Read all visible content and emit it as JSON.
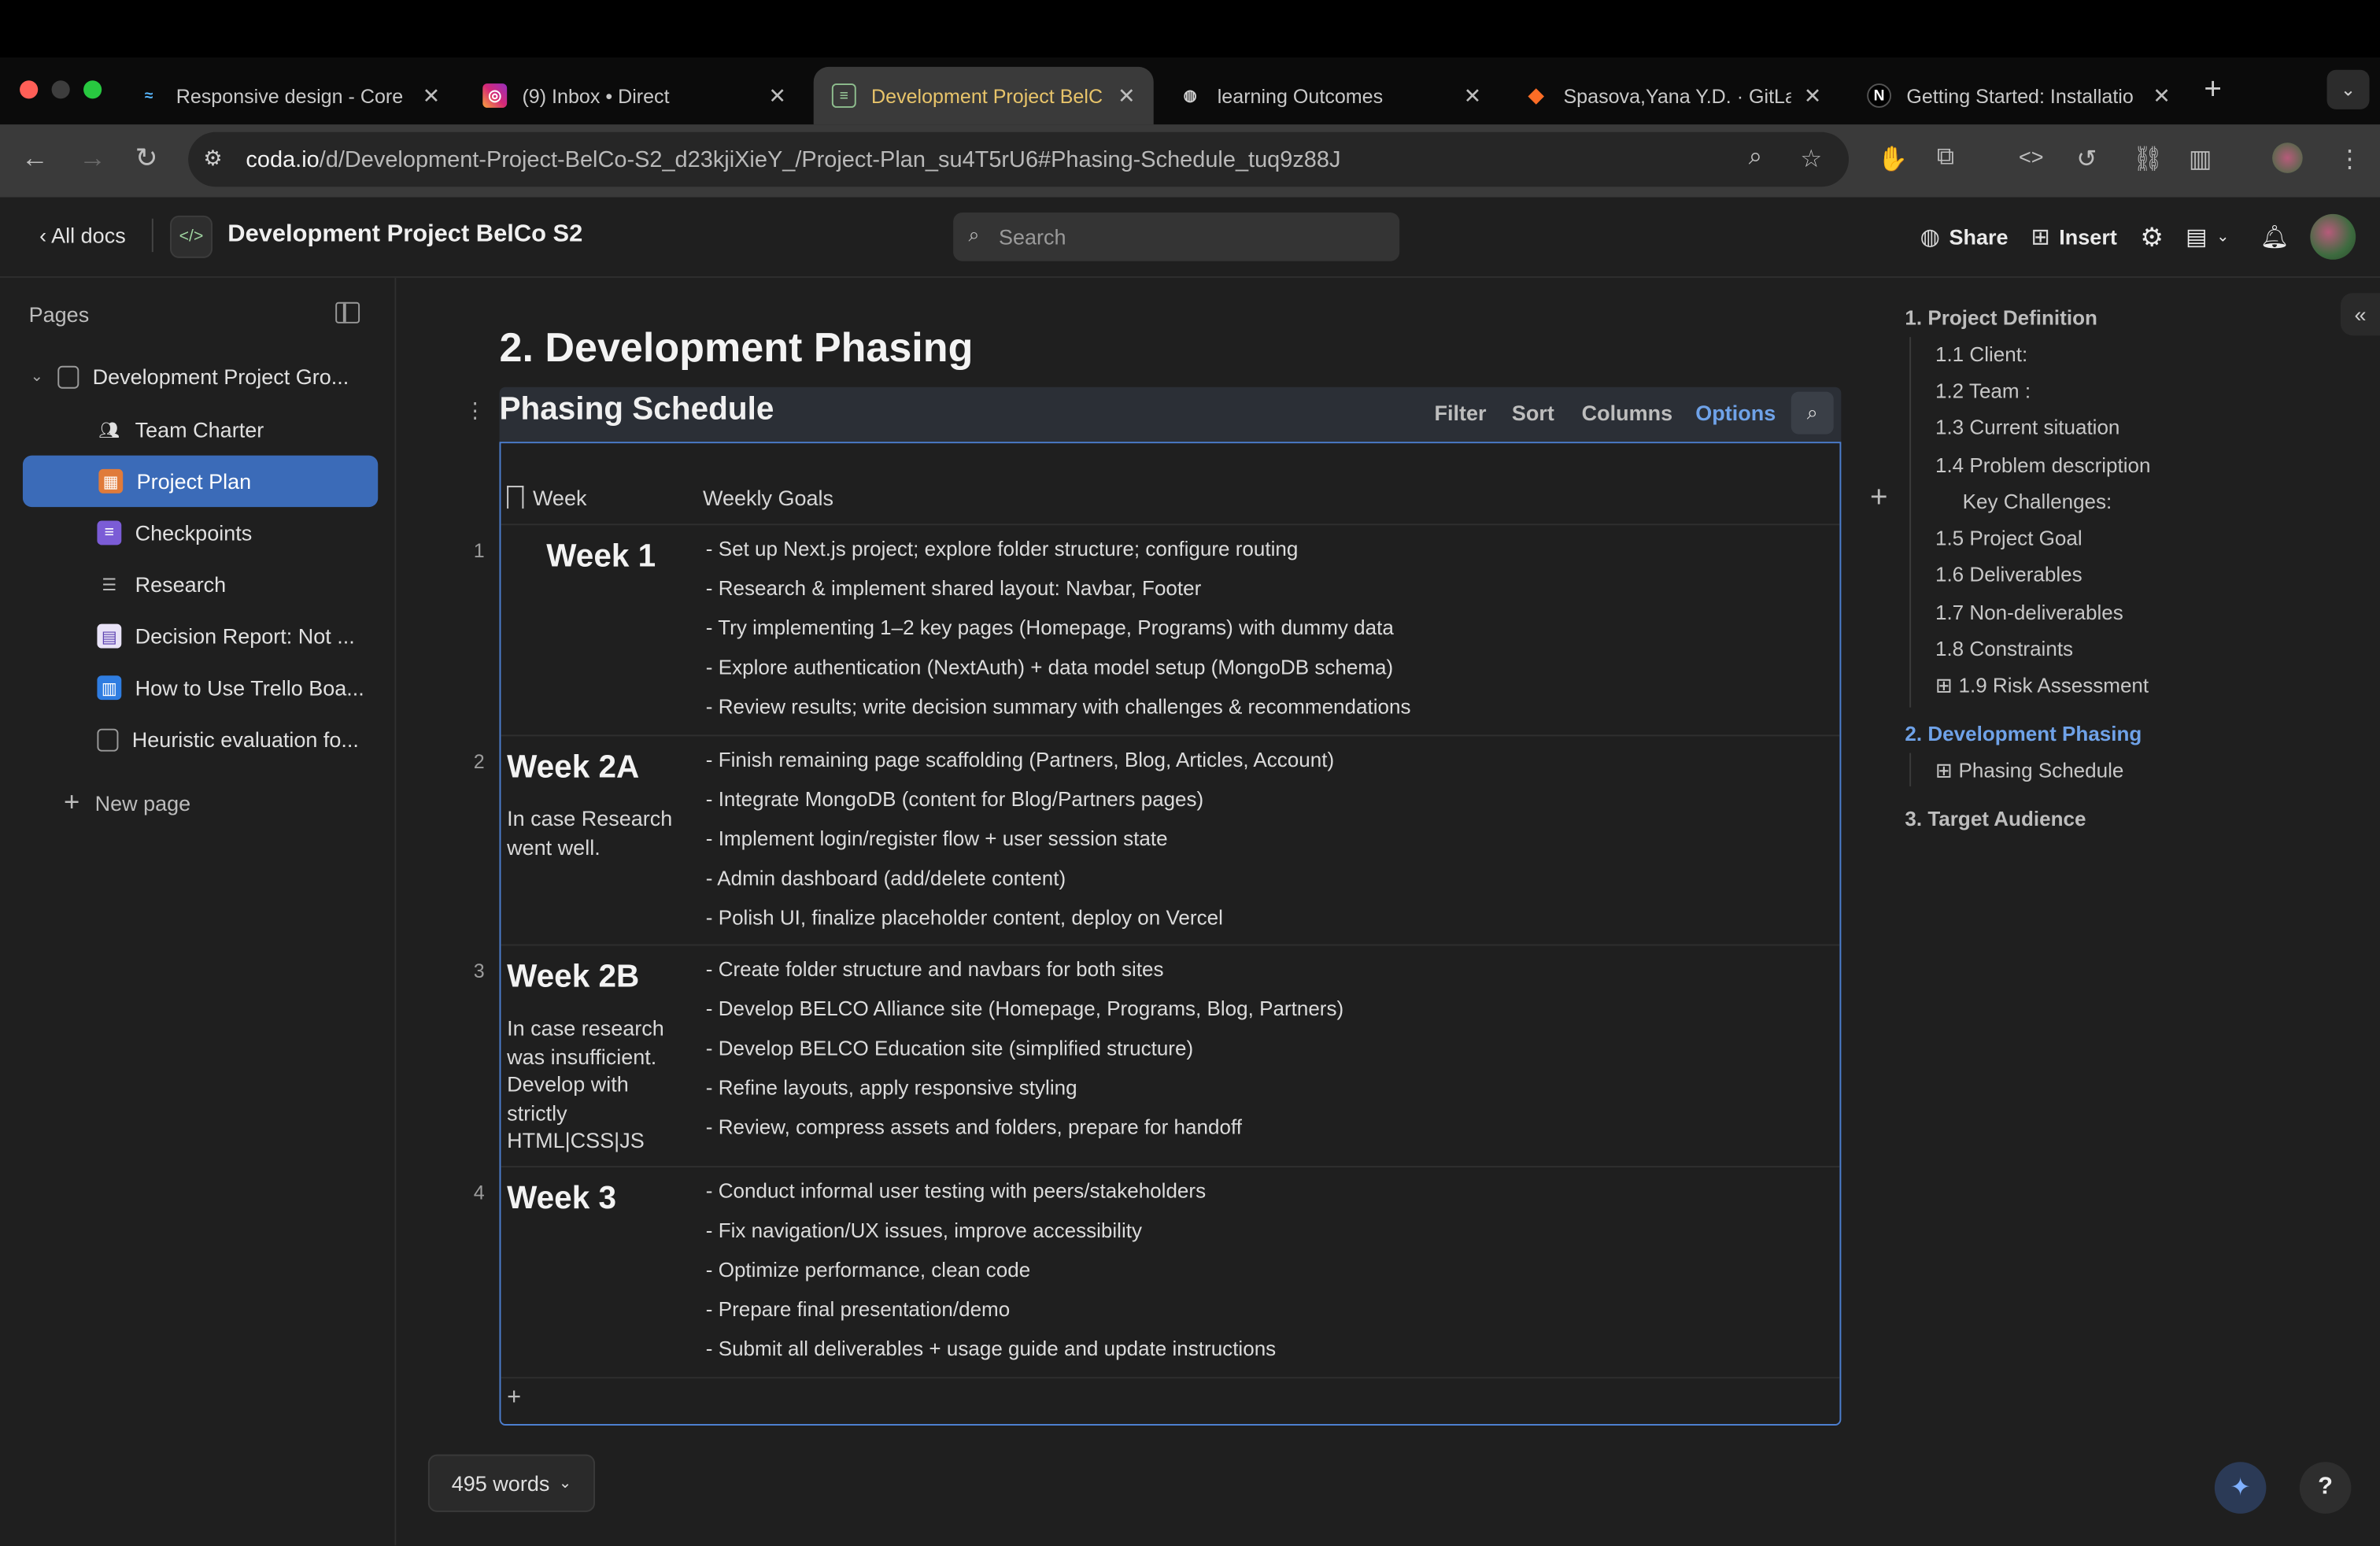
{
  "browser": {
    "tabs": [
      {
        "label": "Responsive design - Core",
        "icon": "waves-icon"
      },
      {
        "label": "(9) Inbox • Direct",
        "icon": "instagram-icon"
      },
      {
        "label": "Development Project BelC",
        "icon": "coda-icon"
      },
      {
        "label": "learning Outcomes",
        "icon": "globe-icon"
      },
      {
        "label": "Spasova,Yana Y.D. · GitLab",
        "icon": "gitlab-icon"
      },
      {
        "label": "Getting Started: Installatio",
        "icon": "nextjs-icon"
      }
    ],
    "url_host": "coda.io",
    "url_path": "/d/Development-Project-BelCo-S2_d23kjiXieY_/Project-Plan_su4T5rU6#Phasing-Schedule_tuq9z88J"
  },
  "header": {
    "all_docs": "All docs",
    "doc_title": "Development Project BelCo S2",
    "search_placeholder": "Search",
    "share": "Share",
    "insert": "Insert"
  },
  "sidebar": {
    "title": "Pages",
    "items": [
      {
        "label": "Development Project Gro..."
      },
      {
        "label": "Team Charter"
      },
      {
        "label": "Project Plan"
      },
      {
        "label": "Checkpoints"
      },
      {
        "label": "Research"
      },
      {
        "label": "Decision Report: Not ..."
      },
      {
        "label": "How to Use Trello Boa..."
      },
      {
        "label": "Heuristic evaluation fo..."
      }
    ],
    "new_page": "New page"
  },
  "main": {
    "heading": "2. Development Phasing",
    "table": {
      "title": "Phasing Schedule",
      "controls": {
        "filter": "Filter",
        "sort": "Sort",
        "columns": "Columns",
        "options": "Options"
      },
      "columns": [
        "Week",
        "Weekly Goals"
      ],
      "rows": [
        {
          "num": "1",
          "week": "Week 1",
          "note": "",
          "goals": [
            "- Set up Next.js project; explore folder structure; configure routing",
            "- Research & implement shared layout: Navbar, Footer",
            "- Try implementing 1–2 key pages (Homepage, Programs) with dummy data",
            "- Explore authentication (NextAuth) + data model setup (MongoDB schema)",
            "- Review results; write decision summary with challenges & recommendations"
          ]
        },
        {
          "num": "2",
          "week": "Week 2A",
          "note": "In case Research went well.",
          "goals": [
            "- Finish remaining page scaffolding (Partners, Blog, Articles, Account)",
            "- Integrate MongoDB (content for Blog/Partners pages)",
            "- Implement login/register flow + user session state",
            "- Admin dashboard (add/delete content)",
            "- Polish UI, finalize placeholder content, deploy on Vercel"
          ]
        },
        {
          "num": "3",
          "week": "Week 2B",
          "note": "In case research was insufficient. Develop with strictly HTML|CSS|JS",
          "goals": [
            "- Create folder structure and navbars for both sites",
            "- Develop BELCO Alliance site (Homepage, Programs, Blog, Partners)",
            "- Develop BELCO Education site (simplified structure)",
            "- Refine layouts, apply responsive styling",
            "- Review, compress assets and folders, prepare for handoff"
          ]
        },
        {
          "num": "4",
          "week": "Week 3",
          "note": "",
          "goals": [
            "- Conduct informal user testing with peers/stakeholders",
            "- Fix navigation/UX issues, improve accessibility",
            "- Optimize performance, clean code",
            "- Prepare final presentation/demo",
            "- Submit all deliverables + usage guide and update instructions"
          ]
        }
      ]
    },
    "word_count": "495 words"
  },
  "outline": {
    "items": [
      {
        "label": "1. Project Definition"
      },
      {
        "label": "1.1 Client:"
      },
      {
        "label": "1.2 Team :"
      },
      {
        "label": "1.3 Current situation"
      },
      {
        "label": "1.4 Problem description"
      },
      {
        "label": "Key Challenges:"
      },
      {
        "label": "1.5 Project Goal"
      },
      {
        "label": "1.6 Deliverables"
      },
      {
        "label": "1.7 Non-deliverables"
      },
      {
        "label": "1.8 Constraints"
      },
      {
        "label": "1.9 Risk Assessment"
      },
      {
        "label": "2. Development Phasing"
      },
      {
        "label": "Phasing Schedule"
      },
      {
        "label": "3. Target Audience"
      }
    ]
  },
  "colors": {
    "accent": "#3b6bb8",
    "link": "#6fa2e8",
    "background": "#1f1f1f"
  }
}
